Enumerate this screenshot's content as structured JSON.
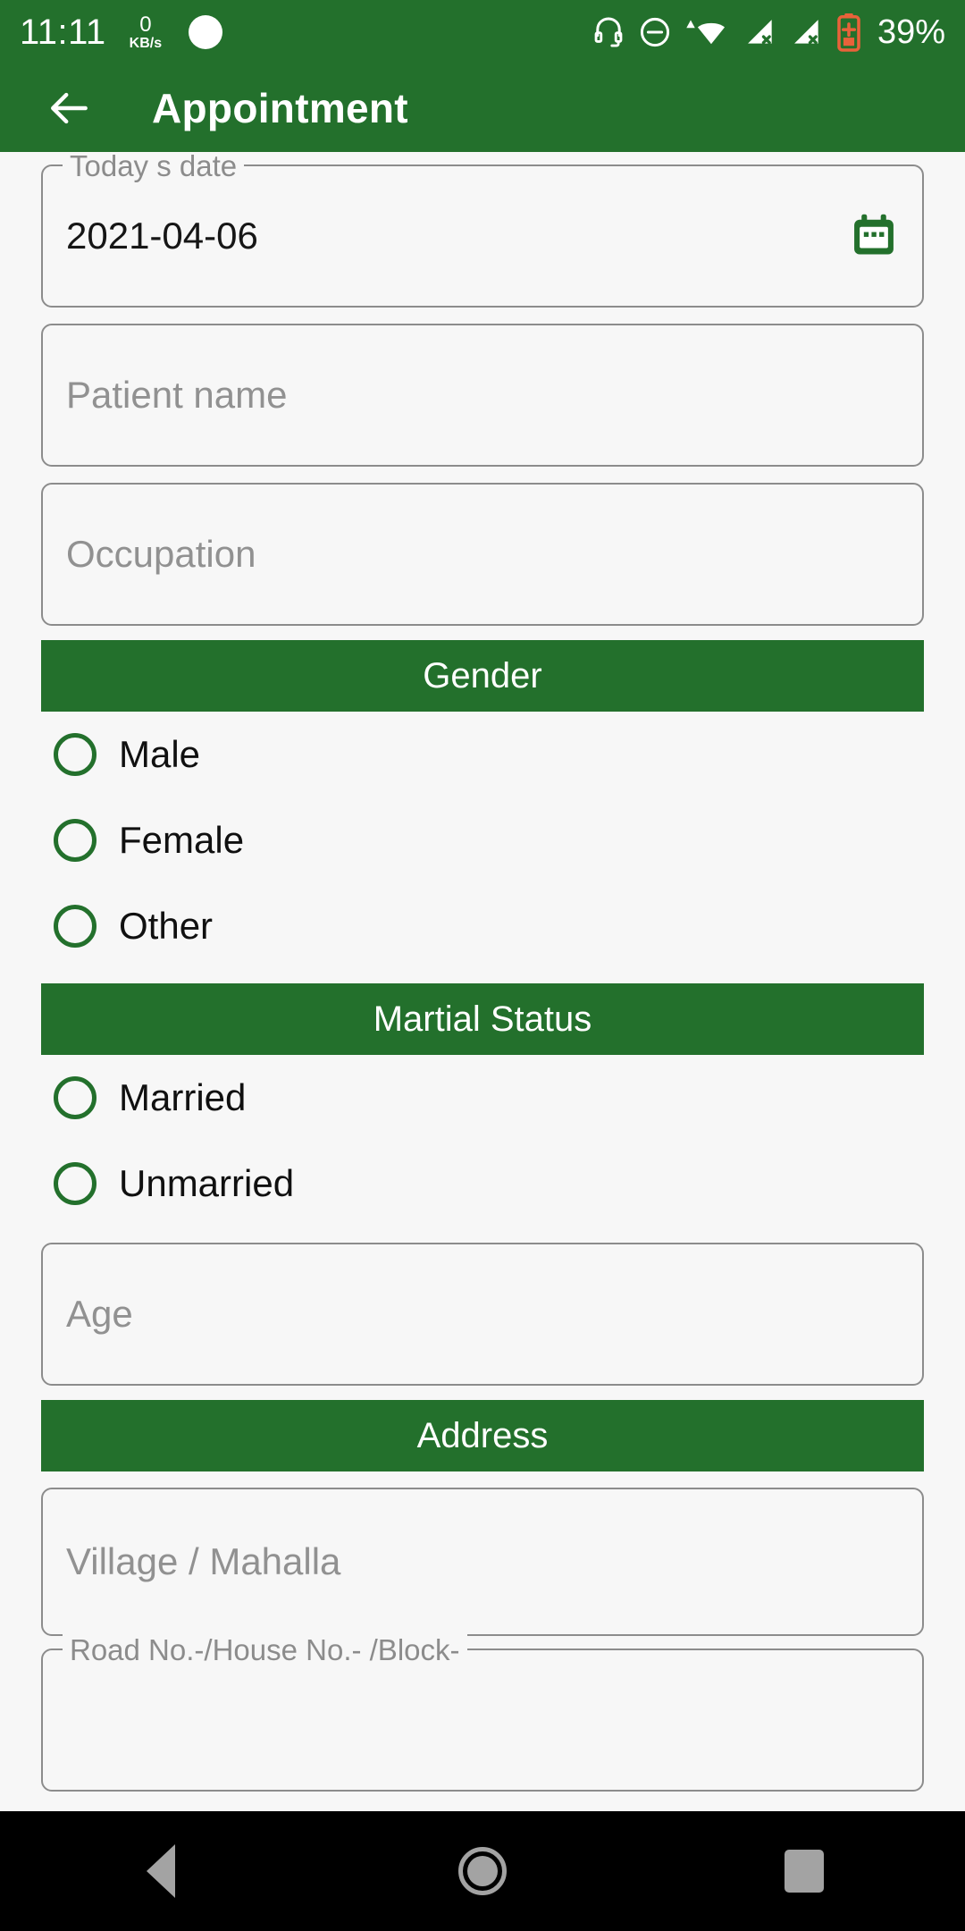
{
  "status_bar": {
    "clock": "11:11",
    "net_speed_value": "0",
    "net_speed_unit": "KB/s",
    "battery_percent": "39%",
    "icons": [
      "notification-dot-icon",
      "headset-icon",
      "do-not-disturb-icon",
      "wifi-icon",
      "signal-sim1-no-service-icon",
      "signal-sim2-no-service-icon",
      "battery-saver-icon"
    ],
    "background_color": "#23702c",
    "foreground_color": "#ffffff",
    "battery_icon_color": "#e8623a"
  },
  "app_bar": {
    "back_icon": "arrow-back-icon",
    "title": "Appointment",
    "background_color": "#23702c"
  },
  "form": {
    "date_field": {
      "label": "Today s date",
      "value": "2021-04-06",
      "trailing_icon": "calendar-icon",
      "icon_color": "#23702c"
    },
    "patient_name_field": {
      "placeholder": "Patient name",
      "value": ""
    },
    "occupation_field": {
      "placeholder": "Occupation",
      "value": ""
    },
    "gender_section": {
      "header": "Gender",
      "options": [
        {
          "label": "Male",
          "selected": false
        },
        {
          "label": "Female",
          "selected": false
        },
        {
          "label": "Other",
          "selected": false
        }
      ]
    },
    "marital_section": {
      "header": "Martial Status",
      "options": [
        {
          "label": "Married",
          "selected": false
        },
        {
          "label": "Unmarried",
          "selected": false
        }
      ]
    },
    "age_field": {
      "placeholder": "Age",
      "value": ""
    },
    "address_section": {
      "header": "Address"
    },
    "village_field": {
      "placeholder": "Village / Mahalla",
      "value": ""
    },
    "road_field": {
      "label": "Road No.-/House No.- /Block-",
      "value": ""
    }
  },
  "nav_bar": {
    "back": "back-nav-icon",
    "home": "home-nav-icon",
    "recents": "recents-nav-icon",
    "background_color": "#000000"
  },
  "theme": {
    "primary_green": "#23702c",
    "page_background": "#f7f7f7",
    "border_grey": "#8c8c8c",
    "placeholder_grey": "#919191"
  }
}
